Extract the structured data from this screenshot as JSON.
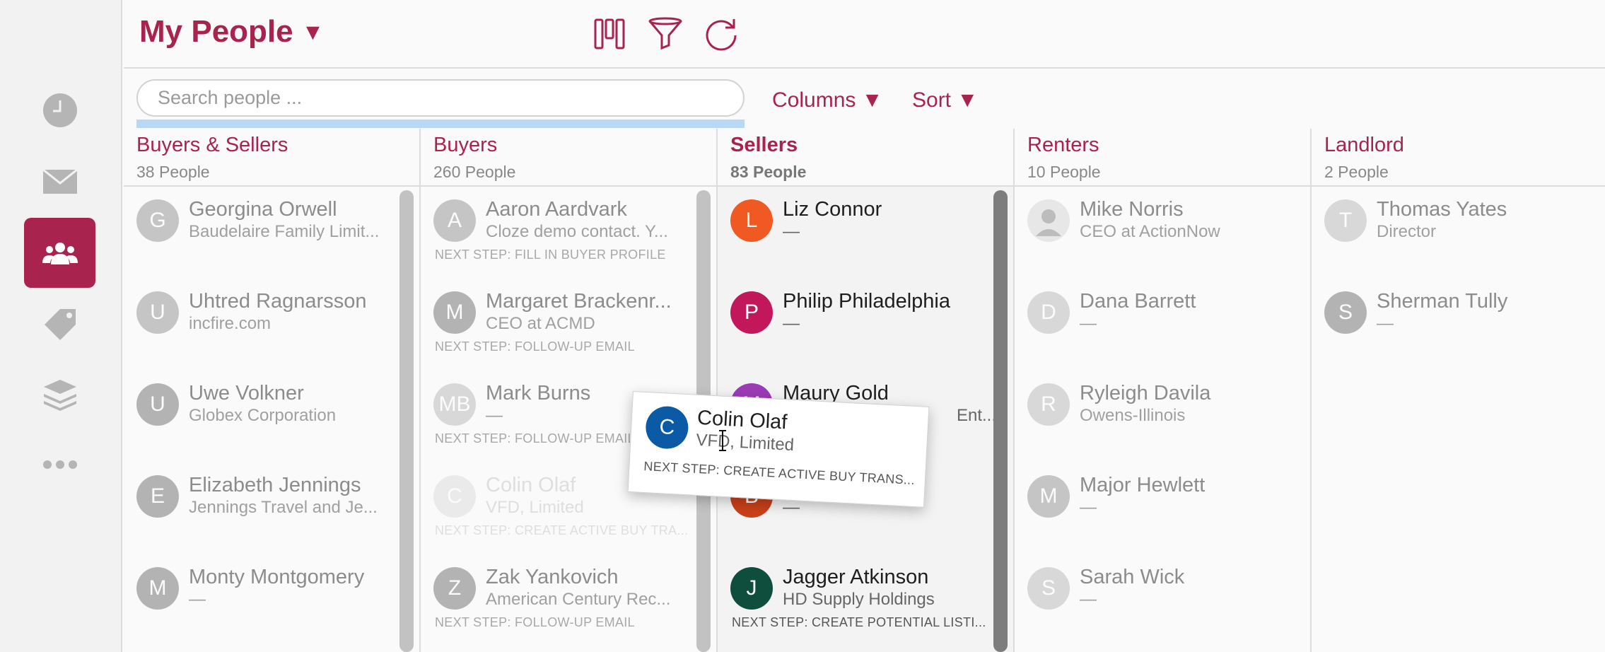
{
  "header": {
    "title": "My People",
    "caret": "▼"
  },
  "toolbar": {
    "search_placeholder": "Search people ...",
    "columns_label": "Columns ▼",
    "sort_label": "Sort ▼"
  },
  "sidebar": {
    "items": [
      {
        "icon": "clock-icon"
      },
      {
        "icon": "mail-icon"
      },
      {
        "icon": "people-icon",
        "active": true
      },
      {
        "icon": "tag-icon"
      },
      {
        "icon": "layers-icon"
      },
      {
        "icon": "more-icon"
      }
    ]
  },
  "colors": {
    "accent": "#a8234e"
  },
  "columns": [
    {
      "name": "Buyers & Sellers",
      "count": "38 People",
      "cards": [
        {
          "initial": "G",
          "name": "Georgina Orwell",
          "sub": "Baudelaire Family Limit...",
          "color": "#9b9b9b"
        },
        {
          "initial": "U",
          "name": "Uhtred Ragnarsson",
          "sub": "incfire.com",
          "color": "#9b9b9b"
        },
        {
          "initial": "U",
          "name": "Uwe Volkner",
          "sub": "Globex Corporation",
          "color": "#7a7a7a"
        },
        {
          "initial": "E",
          "name": "Elizabeth Jennings",
          "sub": "Jennings Travel and Je...",
          "color": "#7a7a7a"
        },
        {
          "initial": "M",
          "name": "Monty Montgomery",
          "sub": "—",
          "color": "#7a7a7a"
        }
      ]
    },
    {
      "name": "Buyers",
      "count": "260 People",
      "cards": [
        {
          "initial": "A",
          "name": "Aaron Aardvark",
          "sub": "Cloze demo contact. Y...",
          "next": "NEXT STEP: FILL IN BUYER PROFILE",
          "color": "#9b9b9b"
        },
        {
          "initial": "M",
          "name": "Margaret Brackenr...",
          "sub": "CEO at ACMD",
          "next": "NEXT STEP: FOLLOW-UP EMAIL",
          "color": "#7a7a7a"
        },
        {
          "initial": "MB",
          "name": "Mark Burns",
          "sub": "—",
          "next": "NEXT STEP: FOLLOW-UP EMAIL",
          "color": "#bdbdbd"
        },
        {
          "initial": "C",
          "name": "Colin Olaf",
          "sub": "VFD, Limited",
          "next": "NEXT STEP: CREATE ACTIVE BUY TRA...",
          "color": "#bdbdbd",
          "ghost": true
        },
        {
          "initial": "Z",
          "name": "Zak Yankovich",
          "sub": "American Century Rec...",
          "next": "NEXT STEP: FOLLOW-UP EMAIL",
          "color": "#7a7a7a"
        }
      ]
    },
    {
      "name": "Sellers",
      "count": "83 People",
      "cards": [
        {
          "initial": "L",
          "name": "Liz Connor",
          "sub": "—",
          "color": "#f05a22"
        },
        {
          "initial": "P",
          "name": "Philip Philadelphia",
          "sub": "—",
          "color": "#c2185b"
        },
        {
          "initial": "M",
          "name": "Maury Gold",
          "sub": "Ent...",
          "color": "#9c3bb5"
        },
        {
          "initial": "B",
          "name": "",
          "sub": "—",
          "color": "#c9401a"
        },
        {
          "initial": "J",
          "name": "Jagger Atkinson",
          "sub": "HD Supply Holdings",
          "next": "NEXT STEP: CREATE POTENTIAL LISTI...",
          "color": "#0f4d3c"
        }
      ]
    },
    {
      "name": "Renters",
      "count": "10 People",
      "cards": [
        {
          "initial": "",
          "name": "Mike Norris",
          "sub": "CEO at ActionNow",
          "color": "#8c8c8c",
          "photo": true
        },
        {
          "initial": "D",
          "name": "Dana Barrett",
          "sub": "—",
          "color": "#bdbdbd"
        },
        {
          "initial": "R",
          "name": "Ryleigh Davila",
          "sub": "Owens-Illinois",
          "color": "#bdbdbd"
        },
        {
          "initial": "M",
          "name": "Major Hewlett",
          "sub": "—",
          "color": "#9b9b9b"
        },
        {
          "initial": "S",
          "name": "Sarah Wick",
          "sub": "—",
          "color": "#bdbdbd"
        }
      ]
    },
    {
      "name": "Landlord",
      "count": "2 People",
      "cards": [
        {
          "initial": "T",
          "name": "Thomas Yates",
          "sub": "Director",
          "color": "#bdbdbd"
        },
        {
          "initial": "S",
          "name": "Sherman Tully",
          "sub": "—",
          "color": "#7a7a7a"
        }
      ]
    }
  ],
  "drag_card": {
    "initial": "C",
    "name": "Colin Olaf",
    "sub": "VFD, Limited",
    "next": "NEXT STEP: CREATE ACTIVE BUY TRANS...",
    "color": "#0b5aa6"
  }
}
